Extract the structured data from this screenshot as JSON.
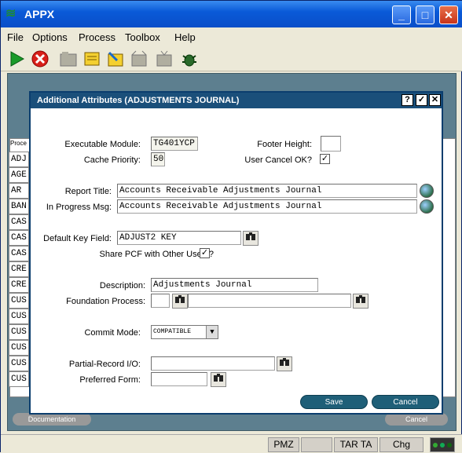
{
  "window": {
    "title": "APPX"
  },
  "menu": [
    "File",
    "Options",
    "Process",
    "Toolbox",
    "Help"
  ],
  "background": {
    "list_header": "Proce",
    "rows": [
      "ADJ",
      "AGE",
      "AR",
      "BAN",
      "CAS",
      "CAS",
      "CAS",
      "CRE",
      "CRE",
      "CUS",
      "CUS",
      "CUS",
      "CUS",
      "CUS",
      "CUS"
    ],
    "doc_button": "Documentation",
    "cancel_button": "Cancel"
  },
  "dialog": {
    "title": "Additional Attributes  (ADJUSTMENTS JOURNAL)",
    "title_buttons": [
      "?",
      "✓",
      "✕"
    ],
    "executable_module": {
      "label": "Executable Module:",
      "value": "TG401YCP"
    },
    "footer_height": {
      "label": "Footer Height:",
      "value": ""
    },
    "cache_priority": {
      "label": "Cache Priority:",
      "value": "50"
    },
    "user_cancel": {
      "label": "User Cancel OK?",
      "checked": "✓"
    },
    "report_title": {
      "label": "Report Title:",
      "value": "Accounts Receivable Adjustments Journal"
    },
    "in_progress": {
      "label": "In Progress Msg:",
      "value": "Accounts Receivable Adjustments Journal"
    },
    "default_key": {
      "label": "Default Key Field:",
      "value": "ADJUST2 KEY"
    },
    "share_pcf": {
      "label": "Share PCF with Other Users?",
      "checked": "✓"
    },
    "description": {
      "label": "Description:",
      "value": "Adjustments Journal"
    },
    "foundation": {
      "label": "Foundation Process:",
      "value1": "",
      "value2": ""
    },
    "commit_mode": {
      "label": "Commit Mode:",
      "value": "COMPATIBLE",
      "arrow": "▼"
    },
    "partial_record": {
      "label": "Partial-Record I/O:",
      "value": ""
    },
    "preferred_form": {
      "label": "Preferred Form:",
      "value": ""
    },
    "save_label": "Save",
    "cancel_label": "Cancel",
    "binoculars": "🔭"
  },
  "status": {
    "cells": [
      "PMZ",
      "",
      "TAR TA",
      "Chg"
    ]
  }
}
